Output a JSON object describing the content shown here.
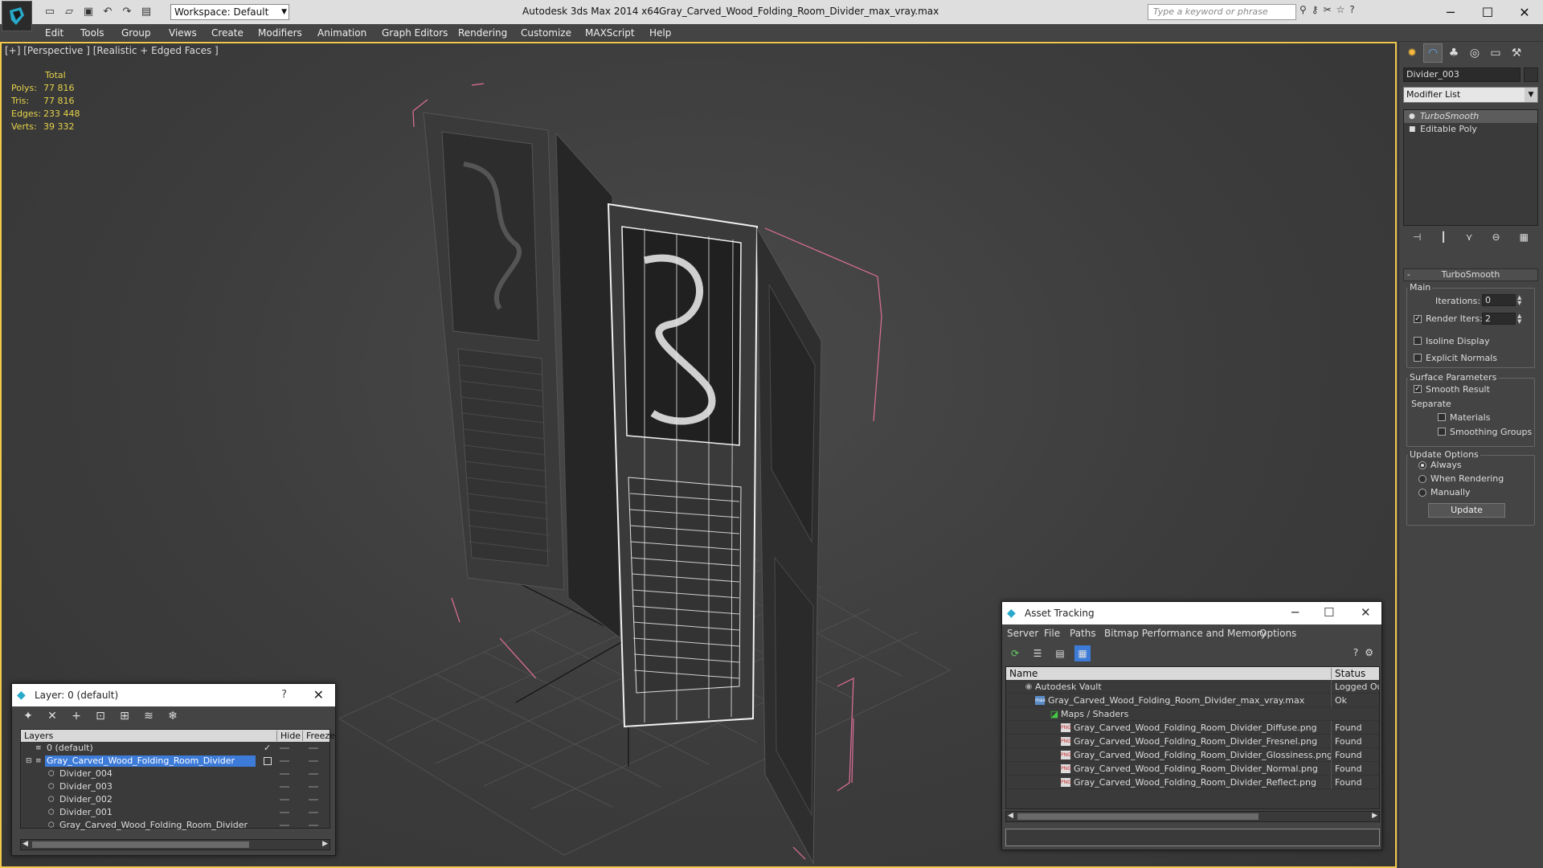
{
  "titlebar": {
    "workspace": "Workspace: Default",
    "app_title": "Autodesk 3ds Max  2014 x64",
    "file_title": "Gray_Carved_Wood_Folding_Room_Divider_max_vray.max",
    "search_placeholder": "Type a keyword or phrase"
  },
  "menu": [
    "Edit",
    "Tools",
    "Group",
    "Views",
    "Create",
    "Modifiers",
    "Animation",
    "Graph Editors",
    "Rendering",
    "Customize",
    "MAXScript",
    "Help"
  ],
  "viewport": {
    "label": "[+] [Perspective ] [Realistic + Edged Faces ]",
    "stats": {
      "header": "Total",
      "rows": [
        {
          "k": "Polys:",
          "v": "77 816"
        },
        {
          "k": "Tris:",
          "v": "77 816"
        },
        {
          "k": "Edges:",
          "v": "233 448"
        },
        {
          "k": "Verts:",
          "v": "39 332"
        }
      ]
    }
  },
  "command_panel": {
    "object_name": "Divider_003",
    "modifier_list": "Modifier List",
    "stack": [
      "TurboSmooth",
      "Editable Poly"
    ],
    "rollout": "TurboSmooth",
    "main_label": "Main",
    "iterations_label": "Iterations:",
    "iterations_value": "0",
    "render_iters_label": "Render Iters:",
    "render_iters_value": "2",
    "isoline": "Isoline Display",
    "explicit_normals": "Explicit Normals",
    "surface_params": "Surface Parameters",
    "smooth_result": "Smooth Result",
    "separate": "Separate",
    "materials": "Materials",
    "smoothing_groups": "Smoothing Groups",
    "update_options": "Update Options",
    "always": "Always",
    "when_rendering": "When Rendering",
    "manually": "Manually",
    "update_button": "Update"
  },
  "layer_dialog": {
    "title": "Layer: 0 (default)",
    "help": "?",
    "col_layers": "Layers",
    "col_hide": "Hide",
    "col_freeze": "Freeze",
    "rows": [
      {
        "name": "0 (default)",
        "indent": 0,
        "selected": false
      },
      {
        "name": "Gray_Carved_Wood_Folding_Room_Divider",
        "indent": 0,
        "selected": true
      },
      {
        "name": "Divider_004",
        "indent": 1,
        "selected": false
      },
      {
        "name": "Divider_003",
        "indent": 1,
        "selected": false
      },
      {
        "name": "Divider_002",
        "indent": 1,
        "selected": false
      },
      {
        "name": "Divider_001",
        "indent": 1,
        "selected": false
      },
      {
        "name": "Gray_Carved_Wood_Folding_Room_Divider",
        "indent": 1,
        "selected": false
      }
    ]
  },
  "asset_dialog": {
    "title": "Asset Tracking",
    "menu": [
      "Server",
      "File",
      "Paths",
      "Bitmap Performance and Memory",
      "Options"
    ],
    "col_name": "Name",
    "col_status": "Status",
    "rows": [
      {
        "name": "Autodesk Vault",
        "status": "Logged Out",
        "indent": 0,
        "icon": "vault"
      },
      {
        "name": "Gray_Carved_Wood_Folding_Room_Divider_max_vray.max",
        "status": "Ok",
        "indent": 1,
        "icon": "max"
      },
      {
        "name": "Maps / Shaders",
        "status": "",
        "indent": 2,
        "icon": "maps"
      },
      {
        "name": "Gray_Carved_Wood_Folding_Room_Divider_Diffuse.png",
        "status": "Found",
        "indent": 3,
        "icon": "png"
      },
      {
        "name": "Gray_Carved_Wood_Folding_Room_Divider_Fresnel.png",
        "status": "Found",
        "indent": 3,
        "icon": "png"
      },
      {
        "name": "Gray_Carved_Wood_Folding_Room_Divider_Glossiness.png",
        "status": "Found",
        "indent": 3,
        "icon": "png"
      },
      {
        "name": "Gray_Carved_Wood_Folding_Room_Divider_Normal.png",
        "status": "Found",
        "indent": 3,
        "icon": "png"
      },
      {
        "name": "Gray_Carved_Wood_Folding_Room_Divider_Reflect.png",
        "status": "Found",
        "indent": 3,
        "icon": "png"
      }
    ]
  },
  "colors": {
    "viewport_border": "#f2c94c",
    "selection_blue": "#3d7bd9",
    "stats_yellow": "#e6d34a",
    "bbox_pink": "#e0709a"
  }
}
